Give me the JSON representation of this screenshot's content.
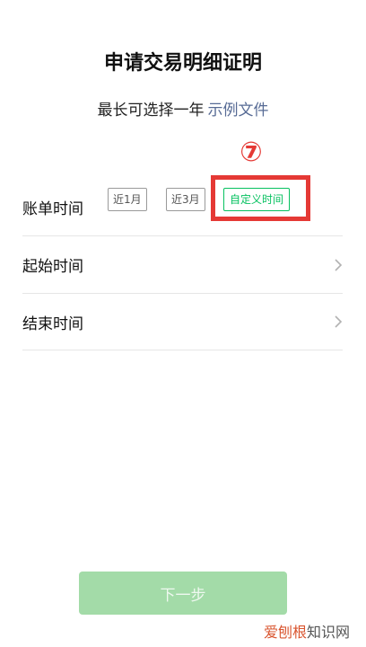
{
  "page": {
    "title": "申请交易明细证明",
    "subtitle_text": "最长可选择一年",
    "subtitle_link": "示例文件",
    "step_marker": "⑦"
  },
  "bill_time": {
    "label": "账单时间",
    "options": [
      "近1月",
      "近3月",
      "自定义时间"
    ],
    "selected": "自定义时间"
  },
  "start_time": {
    "label": "起始时间"
  },
  "end_time": {
    "label": "结束时间"
  },
  "next_button": {
    "label": "下一步"
  },
  "watermark": {
    "accent": "爱刨根",
    "rest": "知识网"
  },
  "colors": {
    "accent_green": "#07c160",
    "link": "#576b95",
    "annotation_red": "#e53935",
    "button_disabled": "#a3dba8"
  }
}
